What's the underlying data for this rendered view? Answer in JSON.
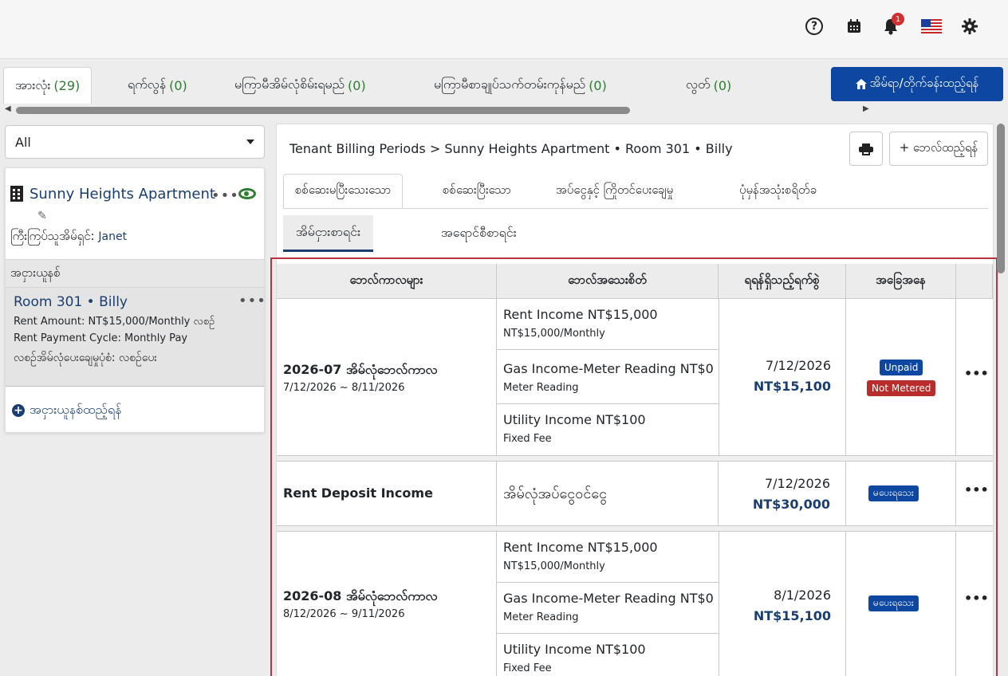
{
  "header": {
    "icons": [
      "help-icon",
      "calendar-icon",
      "bell-icon",
      "us-flag-icon",
      "gear-icon"
    ],
    "notification_count": "1",
    "help_glyph": "?"
  },
  "top_tabs": [
    {
      "label": "အားလုံး",
      "count": "(29)"
    },
    {
      "label": "ရက်လွန်",
      "count": "(0)"
    },
    {
      "label": "မကြာမီအိမ်လုံစိမ်းရမည်",
      "count": "(0)"
    },
    {
      "label": "မကြာမီစာချုပ်သက်တမ်းကုန်မည်",
      "count": "(0)"
    },
    {
      "label": "လွတ်",
      "count": "(0)"
    }
  ],
  "add_property_label": "အိမ်ရာ/တိုက်ခန်းထည့်ရန်",
  "filter": {
    "selected": "All"
  },
  "property": {
    "name": "Sunny Heights Apartment",
    "landlord_label": "ကြီးကြပ်သူအိမ်ရှင်:",
    "landlord_name": "Janet",
    "section_title": "အငှားယူနစ်"
  },
  "contract": {
    "title": "Room 301 • Billy",
    "rent_amount": "Rent Amount: NT$15,000/Monthly လစဉ်",
    "payment_cycle": "Rent Payment Cycle: Monthly Pay",
    "deposit_pattern": "လစဉ်အိမ်လုံပေးချေမှုပုံစံ: လစဉ်ပေး"
  },
  "add_contract_label": "အငှားယူနစ်ထည့်ရန်",
  "breadcrumb": {
    "parent": "Tenant Billing Periods",
    "separator": ">",
    "current": "Sunny Heights Apartment • Room 301 • Billy"
  },
  "add_bill_label": "+ ဘေလ်ထည့်ရန်",
  "billing_tabs": [
    "စစ်ဆေးမပြီးသေးသော",
    "စစ်ဆေးပြီးသော",
    "အပ်ငွေနှင့် ကြိုတင်ပေးချေမှု",
    "ပုံမှန်အသုံးစရိတ်ခ"
  ],
  "bill_type_tabs": [
    "အိမ်ငှားစာရင်း",
    "အရောင်စီစာရင်း"
  ],
  "table": {
    "columns": [
      "ဘေလ်ကာလများ",
      "ဘေလ်အသေးစိတ်",
      "ရရန်ရှိသည့်ရက်စွဲ",
      "အခြေအနေ"
    ],
    "rows": [
      {
        "title": "2026-07 အိမ်လုံဘေလ်ကာလ",
        "range": "7/12/2026 ~ 8/11/2026",
        "items": [
          {
            "title": "Rent Income  NT$15,000",
            "sub": "NT$15,000/Monthly"
          },
          {
            "title": "Gas Income-Meter Reading  NT$0",
            "sub": "Meter Reading"
          },
          {
            "title": "Utility Income  NT$100",
            "sub": "Fixed Fee"
          }
        ],
        "due_date": "7/12/2026",
        "due_amount": "NT$15,100",
        "status": [
          "Unpaid",
          "Not Metered"
        ]
      },
      {
        "title": "Rent Deposit Income",
        "detail": "အိမ်လုံအပ်ငွေဝင်ငွေ",
        "due_date": "7/12/2026",
        "due_amount": "NT$30,000",
        "status": [
          "မပေးရသေး"
        ]
      },
      {
        "title": "2026-08 အိမ်လုံဘေလ်ကာလ",
        "range": "8/12/2026 ~ 9/11/2026",
        "items": [
          {
            "title": "Rent Income  NT$15,000",
            "sub": "NT$15,000/Monthly"
          },
          {
            "title": "Gas Income-Meter Reading  NT$0",
            "sub": "Meter Reading"
          },
          {
            "title": "Utility Income  NT$100",
            "sub": "Fixed Fee"
          }
        ],
        "due_date": "8/1/2026",
        "due_amount": "NT$15,100",
        "status": [
          "မပေးရသေး"
        ]
      }
    ]
  },
  "colors": {
    "primary": "#0d47a1",
    "accent_text": "#1a3e72",
    "count_green": "#2e7d32",
    "alert_red": "#b92c2c",
    "frame_red": "#b7333f"
  }
}
